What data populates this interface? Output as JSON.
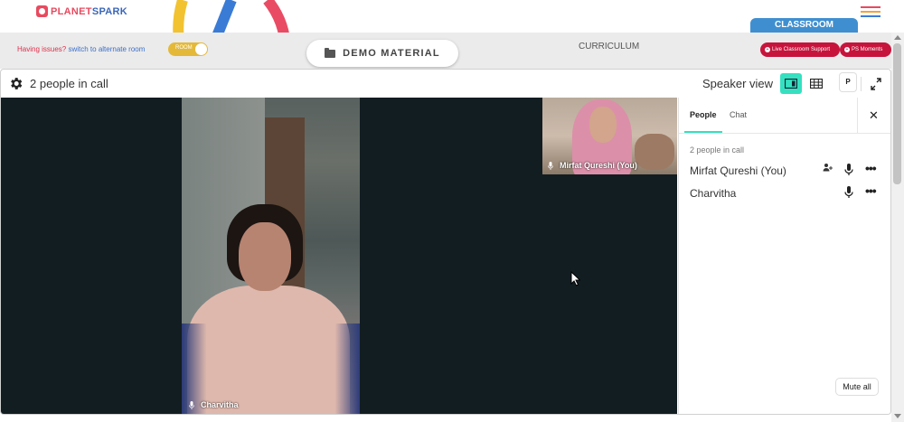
{
  "brand": {
    "name_part1": "PLANET",
    "name_part2": "SPARK"
  },
  "header": {
    "classroom_tab": "CLASSROOM",
    "issues_text": "Having issues?",
    "alternate_room_link": "switch to alternate room",
    "room_toggle_label": "ROOM",
    "demo_material": "DEMO MATERIAL",
    "curriculum": "CURRICULUM",
    "live_support": "Live Classroom Support",
    "ps_moments": "PS Moments"
  },
  "call": {
    "people_in_call": "2 people in call",
    "speaker_view": "Speaker view",
    "p_button": "P",
    "main_participant": "Charvitha",
    "self_participant": "Mirfat Qureshi (You)"
  },
  "sidebar": {
    "tabs": [
      {
        "label": "People"
      },
      {
        "label": "Chat"
      }
    ],
    "people_count": "2 people in call",
    "people": [
      {
        "name": "Mirfat Qureshi (You)"
      },
      {
        "name": "Charvitha"
      }
    ],
    "mute_all": "Mute all"
  },
  "colors": {
    "accent": "#35e0c0",
    "brand_red": "#e84a5f",
    "pill_red": "#c7143c",
    "classroom_blue": "#3f8fd0",
    "stage_bg": "#121d22"
  },
  "icons": [
    "gear-icon",
    "speaker-view-icon",
    "grid-view-icon",
    "expand-icon",
    "mic-icon",
    "more-icon",
    "close-icon",
    "folder-icon",
    "cursor-icon",
    "menu-icon",
    "add-person-icon"
  ]
}
